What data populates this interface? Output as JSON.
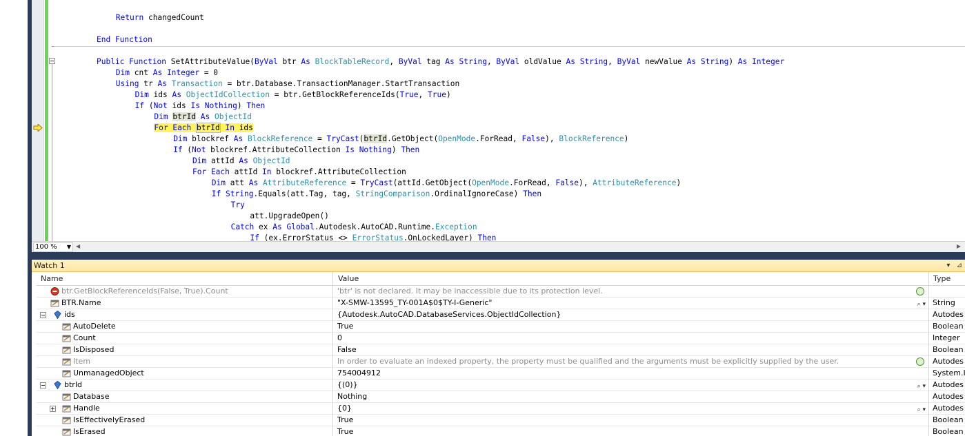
{
  "editor": {
    "zoom": "100 %",
    "lines": [
      {
        "indent": 8,
        "segs": [
          {
            "t": "Return",
            "c": "kw"
          },
          {
            "t": " changedCount"
          }
        ]
      },
      {
        "indent": 0,
        "segs": []
      },
      {
        "indent": 4,
        "segs": [
          {
            "t": "End Function",
            "c": "kw"
          }
        ]
      },
      {
        "indent": 0,
        "segs": []
      },
      {
        "indent": 4,
        "segs": [
          {
            "t": "Public Function",
            "c": "kw"
          },
          {
            "t": " SetAttributeValue("
          },
          {
            "t": "ByVal",
            "c": "kw"
          },
          {
            "t": " btr "
          },
          {
            "t": "As",
            "c": "kw"
          },
          {
            "t": " "
          },
          {
            "t": "BlockTableRecord",
            "c": "ty"
          },
          {
            "t": ", "
          },
          {
            "t": "ByVal",
            "c": "kw"
          },
          {
            "t": " tag "
          },
          {
            "t": "As",
            "c": "kw"
          },
          {
            "t": " "
          },
          {
            "t": "String",
            "c": "kw"
          },
          {
            "t": ", "
          },
          {
            "t": "ByVal",
            "c": "kw"
          },
          {
            "t": " oldValue "
          },
          {
            "t": "As",
            "c": "kw"
          },
          {
            "t": " "
          },
          {
            "t": "String",
            "c": "kw"
          },
          {
            "t": ", "
          },
          {
            "t": "ByVal",
            "c": "kw"
          },
          {
            "t": " newValue "
          },
          {
            "t": "As",
            "c": "kw"
          },
          {
            "t": " "
          },
          {
            "t": "String",
            "c": "kw"
          },
          {
            "t": ") "
          },
          {
            "t": "As",
            "c": "kw"
          },
          {
            "t": " "
          },
          {
            "t": "Integer",
            "c": "kw"
          }
        ]
      },
      {
        "indent": 8,
        "segs": [
          {
            "t": "Dim",
            "c": "kw"
          },
          {
            "t": " cnt "
          },
          {
            "t": "As",
            "c": "kw"
          },
          {
            "t": " "
          },
          {
            "t": "Integer",
            "c": "kw"
          },
          {
            "t": " = 0"
          }
        ]
      },
      {
        "indent": 8,
        "segs": [
          {
            "t": "Using",
            "c": "kw"
          },
          {
            "t": " tr "
          },
          {
            "t": "As",
            "c": "kw"
          },
          {
            "t": " "
          },
          {
            "t": "Transaction",
            "c": "ty"
          },
          {
            "t": " = btr.Database.TransactionManager.StartTransaction"
          }
        ]
      },
      {
        "indent": 12,
        "segs": [
          {
            "t": "Dim",
            "c": "kw"
          },
          {
            "t": " ids "
          },
          {
            "t": "As",
            "c": "kw"
          },
          {
            "t": " "
          },
          {
            "t": "ObjectIdCollection",
            "c": "ty"
          },
          {
            "t": " = btr.GetBlockReferenceIds("
          },
          {
            "t": "True",
            "c": "kw"
          },
          {
            "t": ", "
          },
          {
            "t": "True",
            "c": "kw"
          },
          {
            "t": ")"
          }
        ]
      },
      {
        "indent": 12,
        "segs": [
          {
            "t": "If",
            "c": "kw"
          },
          {
            "t": " ("
          },
          {
            "t": "Not",
            "c": "kw"
          },
          {
            "t": " ids "
          },
          {
            "t": "Is",
            "c": "kw"
          },
          {
            "t": " "
          },
          {
            "t": "Nothing",
            "c": "kw"
          },
          {
            "t": ") "
          },
          {
            "t": "Then",
            "c": "kw"
          }
        ]
      },
      {
        "indent": 16,
        "segs": [
          {
            "t": "Dim",
            "c": "kw"
          },
          {
            "t": " "
          },
          {
            "t": "btrId",
            "c": "hl2"
          },
          {
            "t": " "
          },
          {
            "t": "As",
            "c": "kw"
          },
          {
            "t": " "
          },
          {
            "t": "ObjectId",
            "c": "ty"
          }
        ]
      },
      {
        "indent": 16,
        "current": true,
        "segs": [
          {
            "t": "For Each",
            "c": "kw hl"
          },
          {
            "t": " ",
            "c": "hl"
          },
          {
            "t": "btrId",
            "c": "hl brk"
          },
          {
            "t": " ",
            "c": "hl"
          },
          {
            "t": "In",
            "c": "kw hl"
          },
          {
            "t": " ids",
            "c": "hl"
          }
        ]
      },
      {
        "indent": 20,
        "segs": [
          {
            "t": "Dim",
            "c": "kw"
          },
          {
            "t": " blockref "
          },
          {
            "t": "As",
            "c": "kw"
          },
          {
            "t": " "
          },
          {
            "t": "BlockReference",
            "c": "ty"
          },
          {
            "t": " = "
          },
          {
            "t": "TryCast",
            "c": "kw"
          },
          {
            "t": "("
          },
          {
            "t": "btrId",
            "c": "hl2"
          },
          {
            "t": ".GetObject("
          },
          {
            "t": "OpenMode",
            "c": "ty"
          },
          {
            "t": ".ForRead, "
          },
          {
            "t": "False",
            "c": "kw"
          },
          {
            "t": "), "
          },
          {
            "t": "BlockReference",
            "c": "ty"
          },
          {
            "t": ")"
          }
        ]
      },
      {
        "indent": 20,
        "segs": [
          {
            "t": "If",
            "c": "kw"
          },
          {
            "t": " ("
          },
          {
            "t": "Not",
            "c": "kw"
          },
          {
            "t": " blockref.AttributeCollection "
          },
          {
            "t": "Is",
            "c": "kw"
          },
          {
            "t": " "
          },
          {
            "t": "Nothing",
            "c": "kw"
          },
          {
            "t": ") "
          },
          {
            "t": "Then",
            "c": "kw"
          }
        ]
      },
      {
        "indent": 24,
        "segs": [
          {
            "t": "Dim",
            "c": "kw"
          },
          {
            "t": " attId "
          },
          {
            "t": "As",
            "c": "kw"
          },
          {
            "t": " "
          },
          {
            "t": "ObjectId",
            "c": "ty"
          }
        ]
      },
      {
        "indent": 24,
        "segs": [
          {
            "t": "For Each",
            "c": "kw"
          },
          {
            "t": " attId "
          },
          {
            "t": "In",
            "c": "kw"
          },
          {
            "t": " blockref.AttributeCollection"
          }
        ]
      },
      {
        "indent": 28,
        "segs": [
          {
            "t": "Dim",
            "c": "kw"
          },
          {
            "t": " att "
          },
          {
            "t": "As",
            "c": "kw"
          },
          {
            "t": " "
          },
          {
            "t": "AttributeReference",
            "c": "ty"
          },
          {
            "t": " = "
          },
          {
            "t": "TryCast",
            "c": "kw"
          },
          {
            "t": "(attId.GetObject("
          },
          {
            "t": "OpenMode",
            "c": "ty"
          },
          {
            "t": ".ForRead, "
          },
          {
            "t": "False",
            "c": "kw"
          },
          {
            "t": "), "
          },
          {
            "t": "AttributeReference",
            "c": "ty"
          },
          {
            "t": ")"
          }
        ]
      },
      {
        "indent": 28,
        "segs": [
          {
            "t": "If",
            "c": "kw"
          },
          {
            "t": " "
          },
          {
            "t": "String",
            "c": "kw"
          },
          {
            "t": ".Equals(att.Tag, tag, "
          },
          {
            "t": "StringComparison",
            "c": "ty"
          },
          {
            "t": ".OrdinalIgnoreCase) "
          },
          {
            "t": "Then",
            "c": "kw"
          }
        ]
      },
      {
        "indent": 32,
        "segs": [
          {
            "t": "Try",
            "c": "kw"
          }
        ]
      },
      {
        "indent": 36,
        "segs": [
          {
            "t": "att.UpgradeOpen()"
          }
        ]
      },
      {
        "indent": 32,
        "segs": [
          {
            "t": "Catch",
            "c": "kw"
          },
          {
            "t": " ex "
          },
          {
            "t": "As",
            "c": "kw"
          },
          {
            "t": " "
          },
          {
            "t": "Global",
            "c": "kw"
          },
          {
            "t": ".Autodesk.AutoCAD.Runtime."
          },
          {
            "t": "Exception",
            "c": "ty"
          }
        ]
      },
      {
        "indent": 36,
        "segs": [
          {
            "t": "If",
            "c": "kw"
          },
          {
            "t": " (ex.ErrorStatus <> "
          },
          {
            "t": "ErrorStatus",
            "c": "ty"
          },
          {
            "t": ".OnLockedLayer) "
          },
          {
            "t": "Then",
            "c": "kw"
          }
        ]
      }
    ]
  },
  "watch": {
    "title": "Watch 1",
    "columns": {
      "name": "Name",
      "value": "Value",
      "type": "Type"
    },
    "rows": [
      {
        "level": 0,
        "icon": "error-icon",
        "name": "btr.GetBlockReferenceIds(False, True).Count",
        "value": "'btr' is not declared. It may be inaccessible due to its protection level.",
        "type": "",
        "gray": true,
        "action": "refresh"
      },
      {
        "level": 0,
        "icon": "property-icon",
        "name": "BTR.Name",
        "value": "\"X-SMW-13595_TY-001A$0$TY-I-Generic\"",
        "type": "String",
        "action": "magnifier"
      },
      {
        "level": 0,
        "expander": "minus",
        "icon": "object-icon",
        "name": "ids",
        "value": "{Autodesk.AutoCAD.DatabaseServices.ObjectIdCollection}",
        "type": "Autodes"
      },
      {
        "level": 1,
        "icon": "property-icon",
        "name": "AutoDelete",
        "value": "True",
        "type": "Boolean"
      },
      {
        "level": 1,
        "icon": "property-icon",
        "name": "Count",
        "value": "0",
        "type": "Integer"
      },
      {
        "level": 1,
        "icon": "property-icon",
        "name": "IsDisposed",
        "value": "False",
        "type": "Boolean"
      },
      {
        "level": 1,
        "icon": "property-icon",
        "name": "Item",
        "value": "In order to evaluate an indexed property, the property must be qualified and the arguments must be explicitly supplied by the user.",
        "type": "Autodes",
        "gray": true,
        "action": "refresh"
      },
      {
        "level": 1,
        "icon": "property-icon",
        "name": "UnmanagedObject",
        "value": "754004912",
        "type": "System.I"
      },
      {
        "level": 0,
        "expander": "minus",
        "icon": "object-icon",
        "name": "btrId",
        "value": "{(0)}",
        "type": "Autodes",
        "action": "magnifier"
      },
      {
        "level": 1,
        "icon": "property-icon",
        "name": "Database",
        "value": "Nothing",
        "type": "Autodes"
      },
      {
        "level": 1,
        "expander": "plus",
        "icon": "property-icon",
        "name": "Handle",
        "value": "{0}",
        "type": "Autodes",
        "action": "magnifier"
      },
      {
        "level": 1,
        "icon": "property-icon",
        "name": "IsEffectivelyErased",
        "value": "True",
        "type": "Boolean"
      },
      {
        "level": 1,
        "icon": "property-icon",
        "name": "IsErased",
        "value": "True",
        "type": "Boolean"
      }
    ]
  },
  "colors": {
    "keyword": "#0000ff",
    "type": "#2b91af",
    "current_line": "#fff45c",
    "watch_title": "#ffe7a2",
    "frame": "#2b3c59"
  }
}
